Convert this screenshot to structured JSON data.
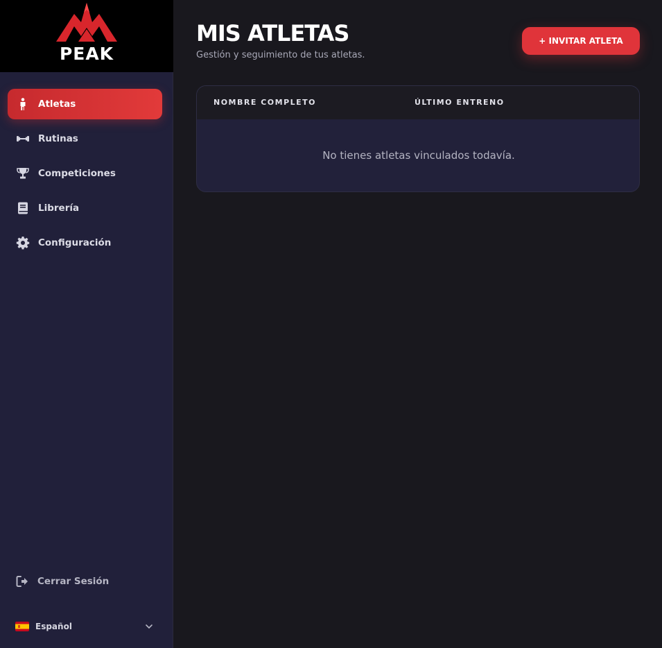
{
  "brand": {
    "name": "PEAK",
    "accent_color": "#e0343a"
  },
  "sidebar": {
    "items": [
      {
        "label": "Atletas",
        "icon": "person-icon",
        "active": true
      },
      {
        "label": "Rutinas",
        "icon": "dumbbell-icon",
        "active": false
      },
      {
        "label": "Competiciones",
        "icon": "trophy-icon",
        "active": false
      },
      {
        "label": "Librería",
        "icon": "book-icon",
        "active": false
      },
      {
        "label": "Configuración",
        "icon": "gear-icon",
        "active": false
      }
    ],
    "logout_label": "Cerrar Sesión",
    "language": {
      "label": "Español",
      "flag": "spain-flag-icon"
    }
  },
  "main": {
    "title": "MIS ATLETAS",
    "subtitle": "Gestión y seguimiento de tus atletas.",
    "invite_button": "+ INVITAR ATLETA",
    "table": {
      "columns": [
        "NOMBRE COMPLETO",
        "ÚLTIMO ENTRENO"
      ],
      "empty_message": "No tienes atletas vinculados todavía."
    }
  }
}
